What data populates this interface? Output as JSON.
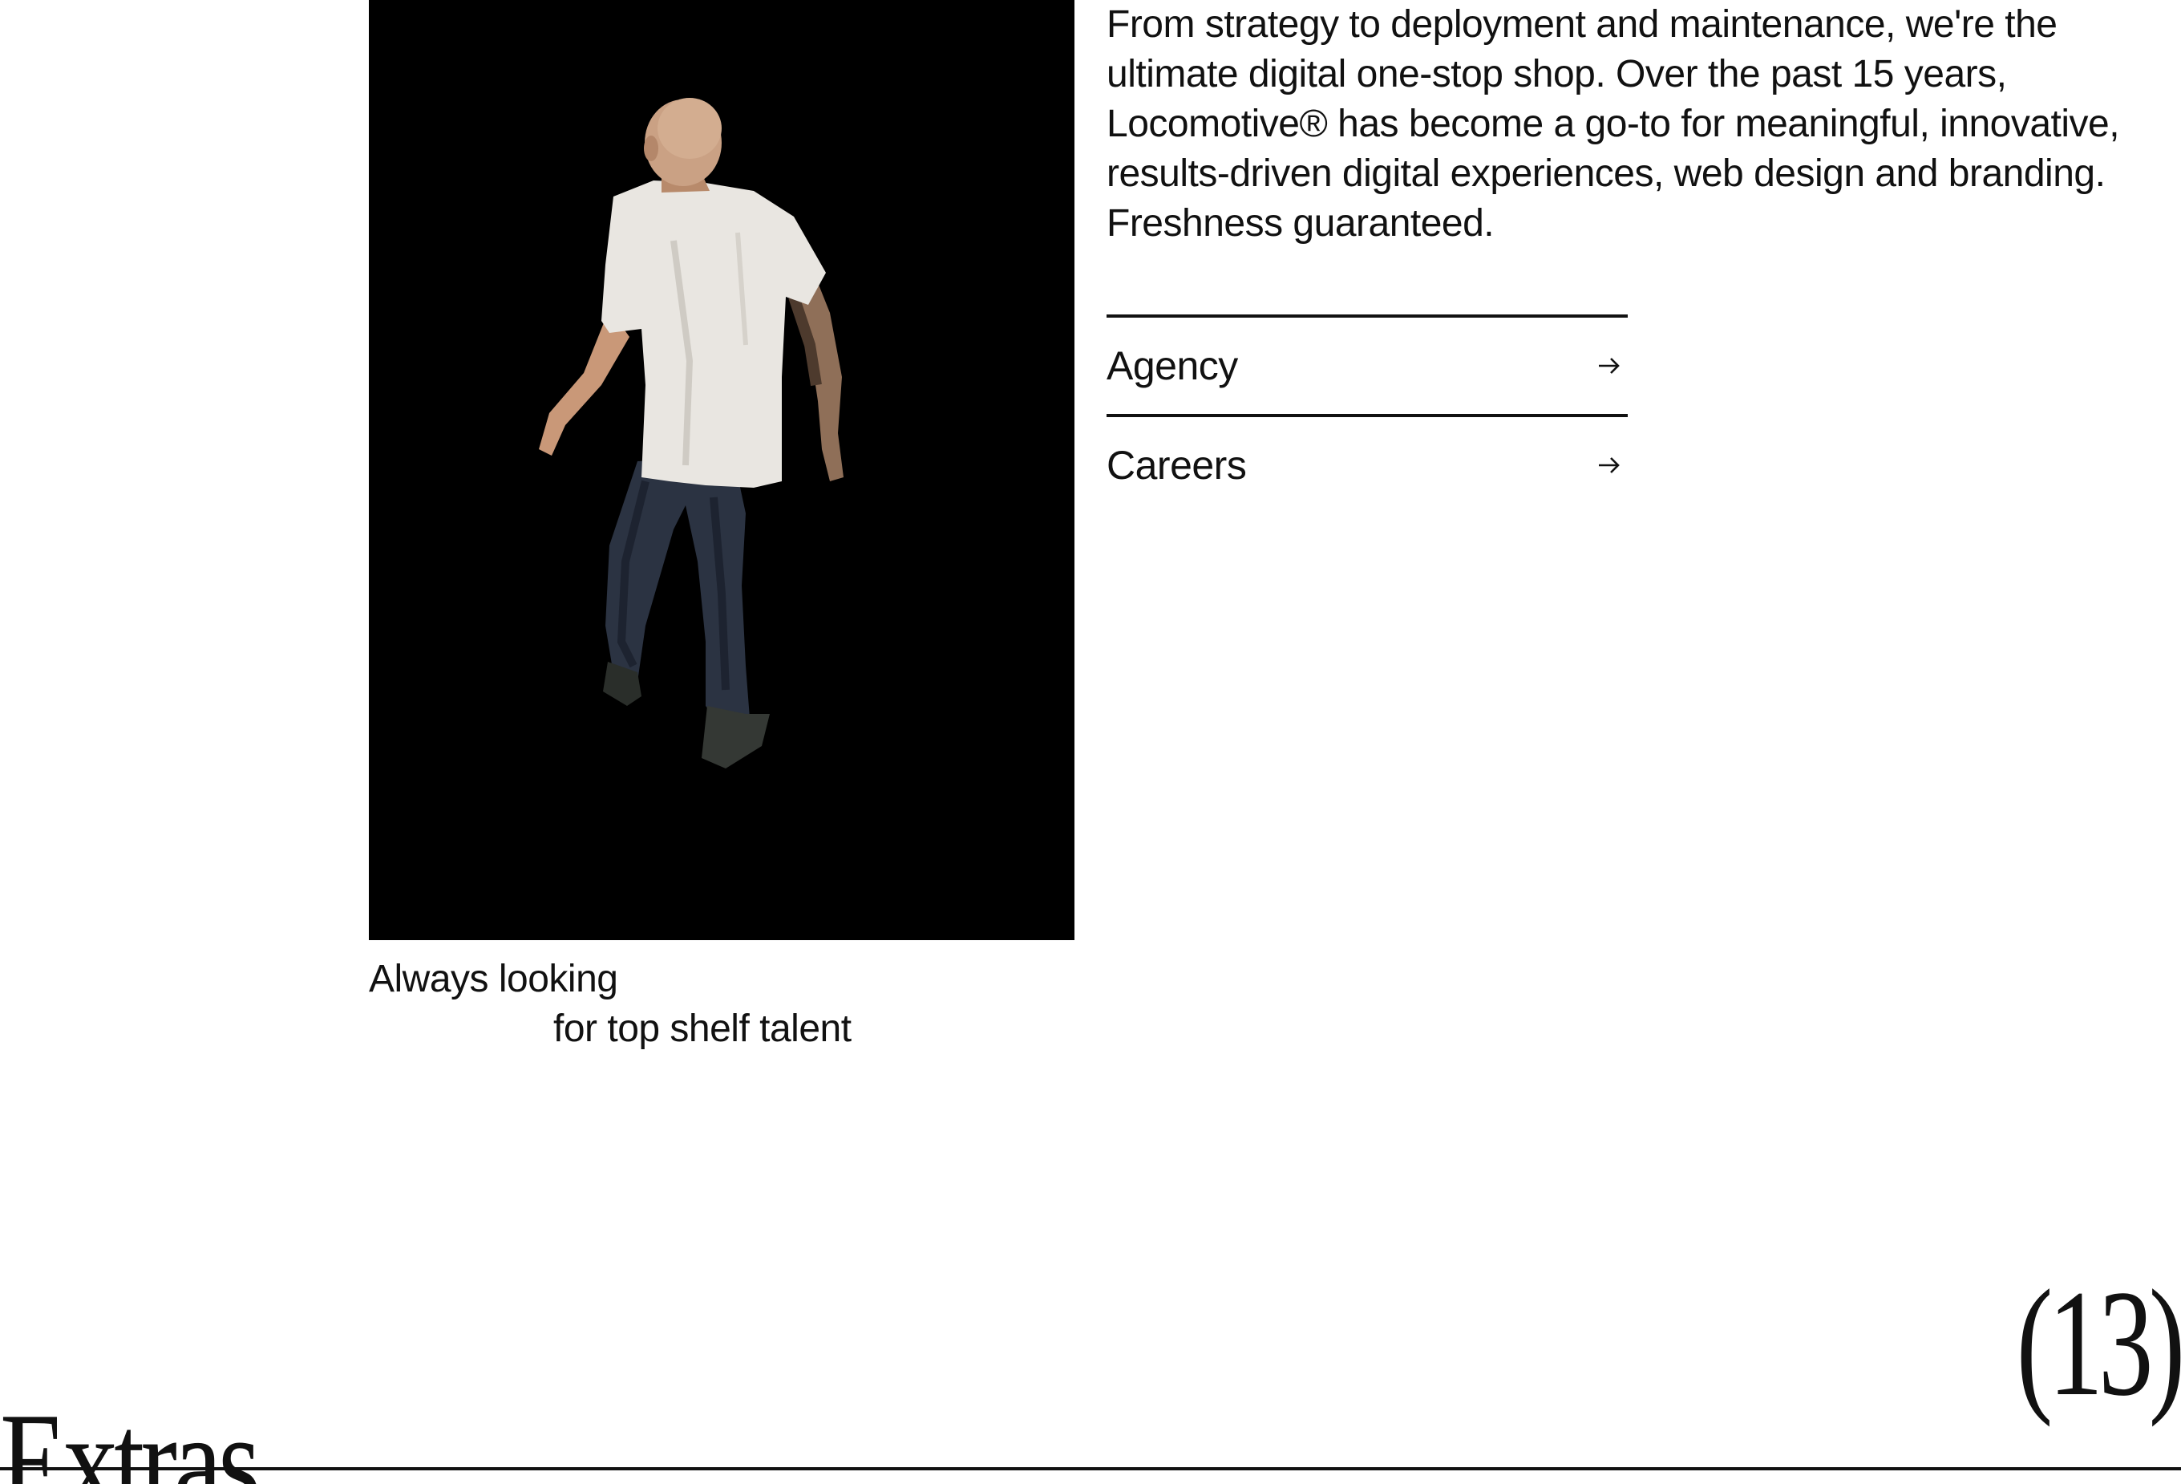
{
  "intro": {
    "text": "From strategy to deployment and maintenance, we're the ultimate digital one-stop shop. Over the past 15 years, Locomotive® has become a go-to for meaningful, innovative, results-driven digital experiences, web design and branding. Freshness guaranteed."
  },
  "links": [
    {
      "label": "Agency",
      "icon": "arrow-right-icon"
    },
    {
      "label": "Careers",
      "icon": "arrow-right-icon"
    }
  ],
  "photo": {
    "caption_line1": "Always looking",
    "caption_line2": "for top shelf talent"
  },
  "section": {
    "title": "Extras",
    "count": "(13)"
  },
  "colors": {
    "background": "#ffffff",
    "text": "#111111",
    "photo_background": "#000000"
  }
}
